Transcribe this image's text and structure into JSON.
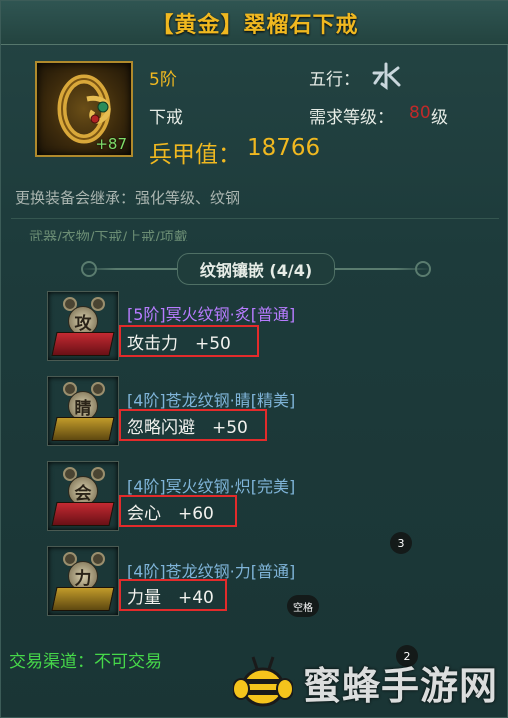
{
  "item": {
    "title": "【黄金】翠榴石下戒",
    "enhance": "+87",
    "grade": "5阶",
    "slot": "下戒",
    "power_label": "兵甲值：",
    "power_value": "18766",
    "element_label": "五行：",
    "element_icon": "water-glyph-icon",
    "req_label": "需求等级：",
    "req_level": "80",
    "req_unit": "级"
  },
  "inherit_text": "更换装备会继承：强化等级、纹钢",
  "faded_slots": "武器/衣物/下戒/上戒/项戴",
  "section_title": "纹钢镶嵌 (4/4)",
  "gems": [
    {
      "glyph": "攻",
      "name": "[5阶]冥火纹钢·炙[普通]",
      "stat": "攻击力　+50",
      "name_color": "#b77cff",
      "gem_color": "#b01f2a"
    },
    {
      "glyph": "睛",
      "name": "[4阶]苍龙纹钢·睛[精美]",
      "stat": "忽略闪避　+50",
      "name_color": "#7fb4d8",
      "gem_color": "#b08a1c"
    },
    {
      "glyph": "会",
      "name": "[4阶]冥火纹钢·炽[完美]",
      "stat": "会心　+60",
      "name_color": "#7fb4d8",
      "gem_color": "#b01f2a"
    },
    {
      "glyph": "力",
      "name": "[4阶]苍龙纹钢·力[普通]",
      "stat": "力量　+40",
      "name_color": "#7fb4d8",
      "gem_color": "#b08a1c"
    }
  ],
  "badges": {
    "badge_3": "3",
    "badge_2": "2",
    "space_key": "空格"
  },
  "trade_text": "交易渠道：不可交易",
  "watermark": "蜜蜂手游网",
  "colors": {
    "gold": "#f0b820",
    "red_req": "#c02a2a",
    "trade_green": "#46d84a",
    "highlight_red": "#e32b2b"
  }
}
